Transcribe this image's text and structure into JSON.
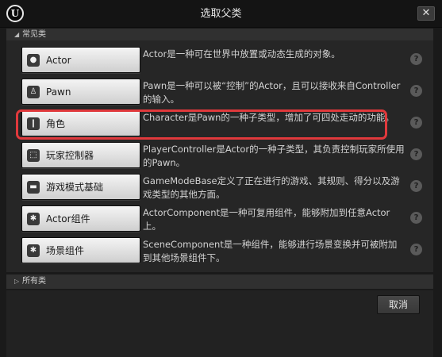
{
  "window": {
    "title": "选取父类",
    "logo_letter": "U",
    "close_label": "✕"
  },
  "common_section": {
    "label": "常见类"
  },
  "classes": [
    {
      "name": "Actor",
      "icon": "sphere-icon",
      "glyph": "●",
      "description": "Actor是一种可在世界中放置或动态生成的对象。",
      "help": "?"
    },
    {
      "name": "Pawn",
      "icon": "pawn-icon",
      "glyph": "♙",
      "description": "Pawn是一种可以被“控制”的Actor，且可以接收来自Controller的输入。",
      "help": "?"
    },
    {
      "name": "角色",
      "icon": "character-icon",
      "glyph": "❙",
      "description": "Character是Pawn的一种子类型，增加了可四处走动的功能。",
      "help": "?"
    },
    {
      "name": "玩家控制器",
      "icon": "controller-icon",
      "glyph": "⬚",
      "description": "PlayerController是Actor的一种子类型，其负责控制玩家所使用的Pawn。",
      "help": "?"
    },
    {
      "name": "游戏模式基础",
      "icon": "gamemode-icon",
      "glyph": "▬",
      "description": "GameModeBase定义了正在进行的游戏、其规则、得分以及游戏类型的其他方面。",
      "help": "?"
    },
    {
      "name": "Actor组件",
      "icon": "component-icon",
      "glyph": "✱",
      "description": "ActorComponent是一种可复用组件，能够附加到任意Actor上。",
      "help": "?"
    },
    {
      "name": "场景组件",
      "icon": "scene-component-icon",
      "glyph": "✱",
      "description": "SceneComponent是一种组件，能够进行场景变换并可被附加到其他场景组件下。",
      "help": "?"
    }
  ],
  "all_classes_section": {
    "label": "所有类"
  },
  "cancel_label": "取消",
  "highlight_color": "#e0393c"
}
